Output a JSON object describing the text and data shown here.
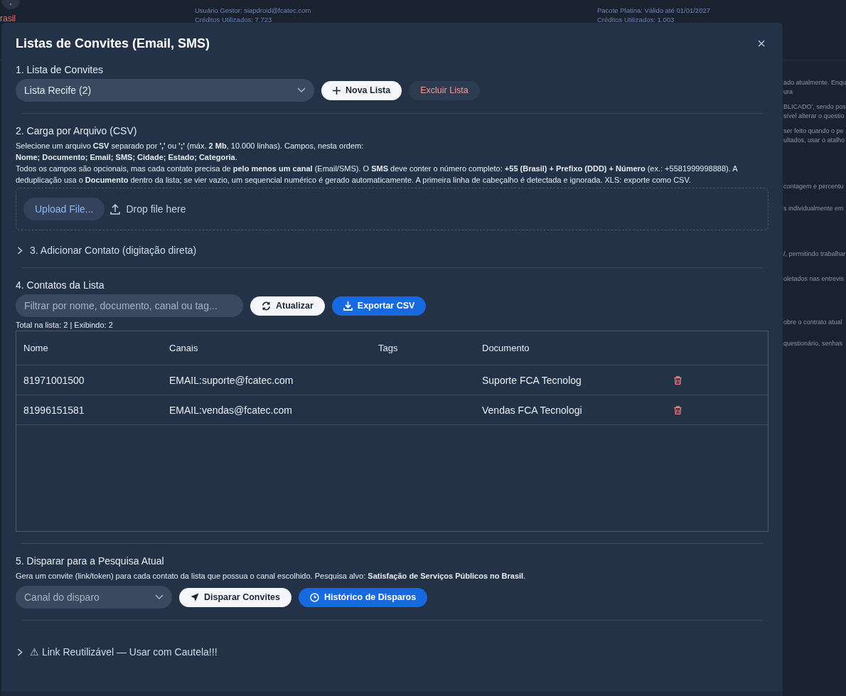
{
  "background": {
    "left_label": "rasil",
    "header_left": [
      "Usuário Gestor: siapdroid@fcatec.com",
      "Créditos Utilizados: 7.723"
    ],
    "header_right": [
      "Pacote Platina: Válido até 01/01/2027",
      "Créditos Utilizados: 1.003"
    ],
    "side_snippets": [
      [
        "ado atualmente. Enqu",
        "ura"
      ],
      [
        "BLICADO', sendo pos",
        "sível alterar o questio"
      ],
      [
        "ser feito quando o pe",
        "ultados, usar o atalho"
      ],
      [
        "contagem e percentu"
      ],
      [
        "s individualmente em"
      ],
      [
        "/, permitindo trabalhar"
      ],
      [
        "oletados nas entrevis"
      ],
      [
        "obre o contrato atual"
      ],
      [
        "questionário, senhas"
      ]
    ]
  },
  "modal": {
    "title": "Listas de Convites (Email, SMS)",
    "close": "×",
    "section1": {
      "heading": "1. Lista de Convites",
      "list_value": "Lista Recife (2)",
      "new_button": "Nova Lista",
      "delete_button": "Excluir Lista"
    },
    "section2": {
      "heading": "2. Carga por Arquivo (CSV)",
      "paragraphs": [
        "Selecione um arquivo **CSV** separado por **','** ou **';'** (máx. **2 Mb**, 10.000 linhas). Campos, nesta ordem:",
        "**Nome; Documento; Email; SMS; Cidade; Estado; Categoria**.",
        "Todos os campos são opcionais, mas cada contato precisa de **pelo menos um canal** (Email/SMS). O **SMS** deve conter o número completo: **+55 (Brasil) + Prefixo (DDD) + Número** (ex.: +5581999998888). A deduplicação usa o **Documento** dentro da lista; se vier vazio, um sequencial numérico é gerado automaticamente. A primeira linha de cabeçalho é detectada e ignorada. XLS: exporte como CSV."
      ],
      "upload_button": "Upload File...",
      "drop_label": "Drop file here"
    },
    "section3": {
      "heading": "3. Adicionar Contato (digitação direta)",
      "expanded": false
    },
    "section4": {
      "heading": "4. Contatos da Lista",
      "filter_placeholder": "Filtrar por nome, documento, canal ou tag...",
      "refresh_button": "Atualizar",
      "export_button": "Exportar CSV",
      "summary": "Total na lista: 2 | Exibindo: 2",
      "table": {
        "columns": [
          "Nome",
          "Canais",
          "Tags",
          "Documento"
        ],
        "rows": [
          {
            "nome": "81971001500",
            "canais": "EMAIL:suporte@fcatec.com",
            "tags": "",
            "documento": "Suporte FCA Tecnolog"
          },
          {
            "nome": "81996151581",
            "canais": "EMAIL:vendas@fcatec.com",
            "tags": "",
            "documento": "Vendas FCA Tecnologi"
          }
        ]
      }
    },
    "section5": {
      "heading": "5. Disparar para a Pesquisa Atual",
      "description": "Gera um convite (link/token) para cada contato da lista que possua o canal escolhido. Pesquisa alvo: **Satisfação de Serviços Públicos no Brasil**.",
      "channel_placeholder": "Canal do disparo",
      "send_button": "Disparar Convites",
      "history_button": "Histórico de Disparos"
    },
    "section6": {
      "heading": "⚠ Link Reutilizável — Usar com Cautela!!!",
      "expanded": false
    }
  }
}
